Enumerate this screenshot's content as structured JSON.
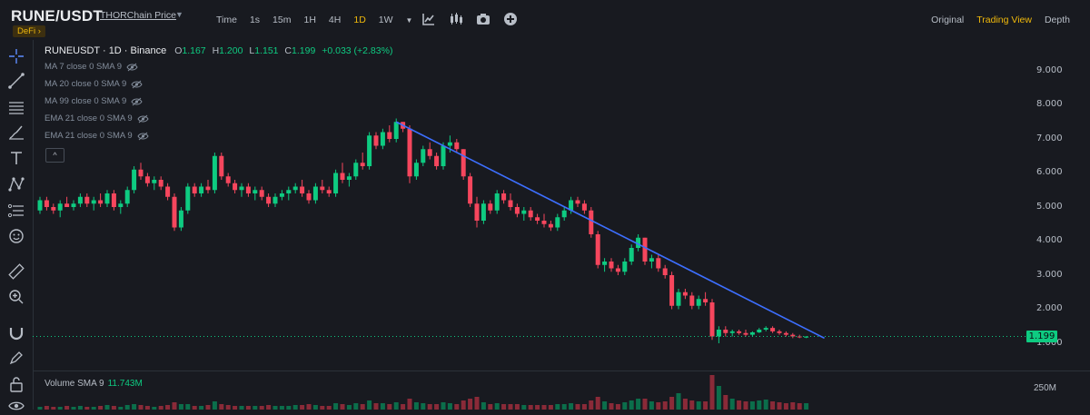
{
  "header": {
    "pair": "RUNE/USDT",
    "source": "THORChain Price",
    "badge": "DeFi",
    "badge_arrow": "›",
    "intervals": [
      "Time",
      "1s",
      "15m",
      "1H",
      "4H",
      "1D",
      "1W"
    ],
    "active_interval": "1D",
    "views": [
      "Original",
      "Trading View",
      "Depth"
    ],
    "active_view": "Trading View"
  },
  "legend": {
    "symbol": "RUNEUSDT · 1D · Binance",
    "open_k": "O",
    "open": "1.167",
    "high_k": "H",
    "high": "1.200",
    "low_k": "L",
    "low": "1.151",
    "close_k": "C",
    "close": "1.199",
    "change": "+0.033 (+2.83%)"
  },
  "indicators": [
    "MA 7 close 0 SMA 9",
    "MA 20 close 0 SMA 9",
    "MA 99 close 0 SMA 9",
    "EMA 21 close 0 SMA 9",
    "EMA 21 close 0 SMA 9"
  ],
  "collapse_icon": "^",
  "y_axis": [
    "9.000",
    "8.000",
    "7.000",
    "6.000",
    "5.000",
    "4.000",
    "3.000",
    "2.000",
    "1.000"
  ],
  "price_label": "1.199",
  "volume": {
    "label": "Volume SMA 9",
    "value": "11.743M",
    "tick": "250M"
  },
  "colors": {
    "up": "#0ecb81",
    "down": "#f6465d",
    "accent": "#f0b90b",
    "trendline": "#3d6fff",
    "bg": "#181a20"
  },
  "chart_data": {
    "type": "candlestick",
    "ylim": [
      0.5,
      9.8
    ],
    "y_ticks": [
      9,
      8,
      7,
      6,
      5,
      4,
      3,
      2,
      1
    ],
    "last_price": 1.199,
    "ohlc": [
      [
        4.9,
        5.3,
        4.8,
        5.2
      ],
      [
        5.2,
        5.3,
        4.9,
        5.0
      ],
      [
        5.0,
        5.1,
        4.8,
        4.9
      ],
      [
        4.9,
        5.2,
        4.7,
        5.1
      ],
      [
        5.1,
        5.3,
        5.0,
        5.0
      ],
      [
        5.0,
        5.2,
        4.9,
        5.1
      ],
      [
        5.1,
        5.4,
        5.0,
        5.3
      ],
      [
        5.3,
        5.4,
        5.0,
        5.1
      ],
      [
        5.1,
        5.3,
        4.9,
        5.2
      ],
      [
        5.2,
        5.4,
        5.0,
        5.1
      ],
      [
        5.1,
        5.5,
        5.0,
        5.4
      ],
      [
        5.4,
        5.5,
        4.9,
        5.0
      ],
      [
        5.0,
        5.2,
        4.8,
        5.1
      ],
      [
        5.1,
        5.6,
        5.0,
        5.5
      ],
      [
        5.5,
        6.2,
        5.4,
        6.1
      ],
      [
        6.1,
        6.3,
        5.8,
        5.9
      ],
      [
        5.9,
        6.0,
        5.6,
        5.7
      ],
      [
        5.7,
        5.9,
        5.5,
        5.8
      ],
      [
        5.8,
        5.9,
        5.5,
        5.6
      ],
      [
        5.6,
        5.7,
        5.2,
        5.3
      ],
      [
        5.3,
        5.4,
        4.3,
        4.4
      ],
      [
        4.4,
        5.0,
        4.3,
        4.9
      ],
      [
        4.9,
        5.7,
        4.8,
        5.6
      ],
      [
        5.6,
        5.7,
        5.3,
        5.4
      ],
      [
        5.4,
        5.7,
        5.3,
        5.6
      ],
      [
        5.6,
        5.8,
        5.4,
        5.5
      ],
      [
        5.5,
        6.6,
        5.4,
        6.5
      ],
      [
        6.5,
        6.6,
        5.8,
        5.9
      ],
      [
        5.9,
        6.0,
        5.6,
        5.7
      ],
      [
        5.7,
        5.8,
        5.4,
        5.5
      ],
      [
        5.5,
        5.7,
        5.3,
        5.6
      ],
      [
        5.6,
        5.7,
        5.3,
        5.4
      ],
      [
        5.4,
        5.6,
        5.2,
        5.5
      ],
      [
        5.5,
        5.6,
        5.2,
        5.3
      ],
      [
        5.3,
        5.4,
        5.0,
        5.1
      ],
      [
        5.1,
        5.4,
        5.0,
        5.3
      ],
      [
        5.3,
        5.5,
        5.2,
        5.4
      ],
      [
        5.4,
        5.6,
        5.2,
        5.5
      ],
      [
        5.5,
        5.7,
        5.4,
        5.6
      ],
      [
        5.6,
        5.8,
        5.3,
        5.4
      ],
      [
        5.4,
        5.5,
        5.1,
        5.2
      ],
      [
        5.2,
        5.7,
        5.1,
        5.6
      ],
      [
        5.6,
        5.8,
        5.4,
        5.5
      ],
      [
        5.5,
        5.6,
        5.3,
        5.4
      ],
      [
        5.4,
        6.1,
        5.3,
        6.0
      ],
      [
        6.0,
        6.3,
        5.7,
        5.8
      ],
      [
        5.8,
        6.0,
        5.6,
        5.9
      ],
      [
        5.9,
        6.4,
        5.8,
        6.3
      ],
      [
        6.3,
        6.6,
        6.1,
        6.2
      ],
      [
        6.2,
        7.2,
        6.1,
        7.1
      ],
      [
        7.1,
        7.2,
        6.7,
        6.8
      ],
      [
        6.8,
        7.3,
        6.7,
        7.2
      ],
      [
        7.2,
        7.4,
        6.9,
        7.0
      ],
      [
        7.0,
        7.6,
        6.9,
        7.5
      ],
      [
        7.5,
        7.5,
        7.2,
        7.3
      ],
      [
        7.3,
        7.4,
        5.7,
        5.9
      ],
      [
        5.9,
        6.4,
        5.8,
        6.3
      ],
      [
        6.3,
        6.8,
        6.2,
        6.7
      ],
      [
        6.7,
        6.9,
        6.4,
        6.5
      ],
      [
        6.5,
        6.6,
        6.1,
        6.2
      ],
      [
        6.2,
        6.9,
        6.1,
        6.8
      ],
      [
        6.8,
        7.1,
        6.6,
        6.9
      ],
      [
        6.9,
        7.0,
        6.6,
        6.7
      ],
      [
        6.7,
        6.7,
        5.8,
        5.9
      ],
      [
        5.9,
        6.0,
        5.0,
        5.1
      ],
      [
        5.1,
        5.3,
        4.4,
        4.6
      ],
      [
        4.6,
        5.2,
        4.5,
        5.1
      ],
      [
        5.1,
        5.2,
        4.8,
        4.9
      ],
      [
        4.9,
        5.5,
        4.8,
        5.4
      ],
      [
        5.4,
        5.5,
        5.1,
        5.2
      ],
      [
        5.2,
        5.4,
        4.9,
        5.0
      ],
      [
        5.0,
        5.1,
        4.7,
        4.8
      ],
      [
        4.8,
        5.0,
        4.6,
        4.9
      ],
      [
        4.9,
        5.0,
        4.6,
        4.7
      ],
      [
        4.7,
        4.8,
        4.5,
        4.6
      ],
      [
        4.6,
        4.8,
        4.4,
        4.5
      ],
      [
        4.5,
        4.6,
        4.3,
        4.4
      ],
      [
        4.4,
        4.8,
        4.3,
        4.7
      ],
      [
        4.7,
        5.0,
        4.6,
        4.9
      ],
      [
        4.9,
        5.3,
        4.8,
        5.2
      ],
      [
        5.2,
        5.3,
        5.0,
        5.1
      ],
      [
        5.1,
        5.2,
        4.8,
        4.9
      ],
      [
        4.9,
        5.0,
        4.1,
        4.2
      ],
      [
        4.2,
        4.3,
        3.2,
        3.3
      ],
      [
        3.3,
        3.5,
        3.1,
        3.4
      ],
      [
        3.4,
        3.5,
        3.1,
        3.2
      ],
      [
        3.2,
        3.3,
        3.0,
        3.1
      ],
      [
        3.1,
        3.5,
        3.0,
        3.4
      ],
      [
        3.4,
        3.9,
        3.3,
        3.8
      ],
      [
        3.8,
        4.2,
        3.7,
        4.1
      ],
      [
        4.1,
        4.1,
        3.3,
        3.4
      ],
      [
        3.4,
        3.6,
        3.2,
        3.5
      ],
      [
        3.5,
        3.6,
        3.1,
        3.2
      ],
      [
        3.2,
        3.3,
        2.9,
        3.0
      ],
      [
        3.0,
        3.1,
        2.0,
        2.1
      ],
      [
        2.1,
        2.6,
        2.0,
        2.5
      ],
      [
        2.5,
        2.6,
        2.3,
        2.4
      ],
      [
        2.4,
        2.5,
        2.0,
        2.1
      ],
      [
        2.1,
        2.4,
        2.0,
        2.3
      ],
      [
        2.3,
        2.5,
        2.1,
        2.2
      ],
      [
        2.2,
        2.3,
        1.1,
        1.2
      ],
      [
        1.2,
        1.5,
        1.0,
        1.4
      ],
      [
        1.4,
        1.5,
        1.2,
        1.3
      ],
      [
        1.3,
        1.4,
        1.2,
        1.35
      ],
      [
        1.35,
        1.4,
        1.25,
        1.3
      ],
      [
        1.3,
        1.4,
        1.2,
        1.25
      ],
      [
        1.25,
        1.35,
        1.2,
        1.32
      ],
      [
        1.32,
        1.45,
        1.3,
        1.4
      ],
      [
        1.4,
        1.5,
        1.35,
        1.45
      ],
      [
        1.45,
        1.5,
        1.3,
        1.35
      ],
      [
        1.35,
        1.4,
        1.25,
        1.3
      ],
      [
        1.3,
        1.35,
        1.2,
        1.25
      ],
      [
        1.25,
        1.3,
        1.15,
        1.2
      ],
      [
        1.2,
        1.25,
        1.15,
        1.18
      ],
      [
        1.167,
        1.2,
        1.151,
        1.199
      ]
    ],
    "volume": [
      3,
      4,
      3,
      3,
      4,
      3,
      4,
      3,
      3,
      4,
      5,
      4,
      3,
      5,
      6,
      5,
      4,
      3,
      4,
      5,
      8,
      6,
      6,
      4,
      4,
      5,
      9,
      6,
      5,
      4,
      4,
      4,
      4,
      4,
      5,
      4,
      4,
      4,
      5,
      5,
      6,
      5,
      4,
      4,
      7,
      6,
      5,
      7,
      6,
      10,
      7,
      7,
      6,
      8,
      6,
      12,
      8,
      7,
      6,
      6,
      8,
      7,
      6,
      10,
      12,
      14,
      8,
      6,
      7,
      6,
      6,
      6,
      5,
      5,
      5,
      5,
      5,
      6,
      6,
      7,
      6,
      6,
      10,
      14,
      9,
      7,
      6,
      8,
      10,
      12,
      12,
      9,
      8,
      9,
      14,
      18,
      12,
      10,
      9,
      9,
      38,
      26,
      16,
      12,
      10,
      9,
      9,
      10,
      11,
      9,
      8,
      7,
      8,
      7,
      7
    ],
    "trendline": {
      "from": [
        53,
        7.5
      ],
      "to": [
        114,
        1.15
      ]
    }
  }
}
